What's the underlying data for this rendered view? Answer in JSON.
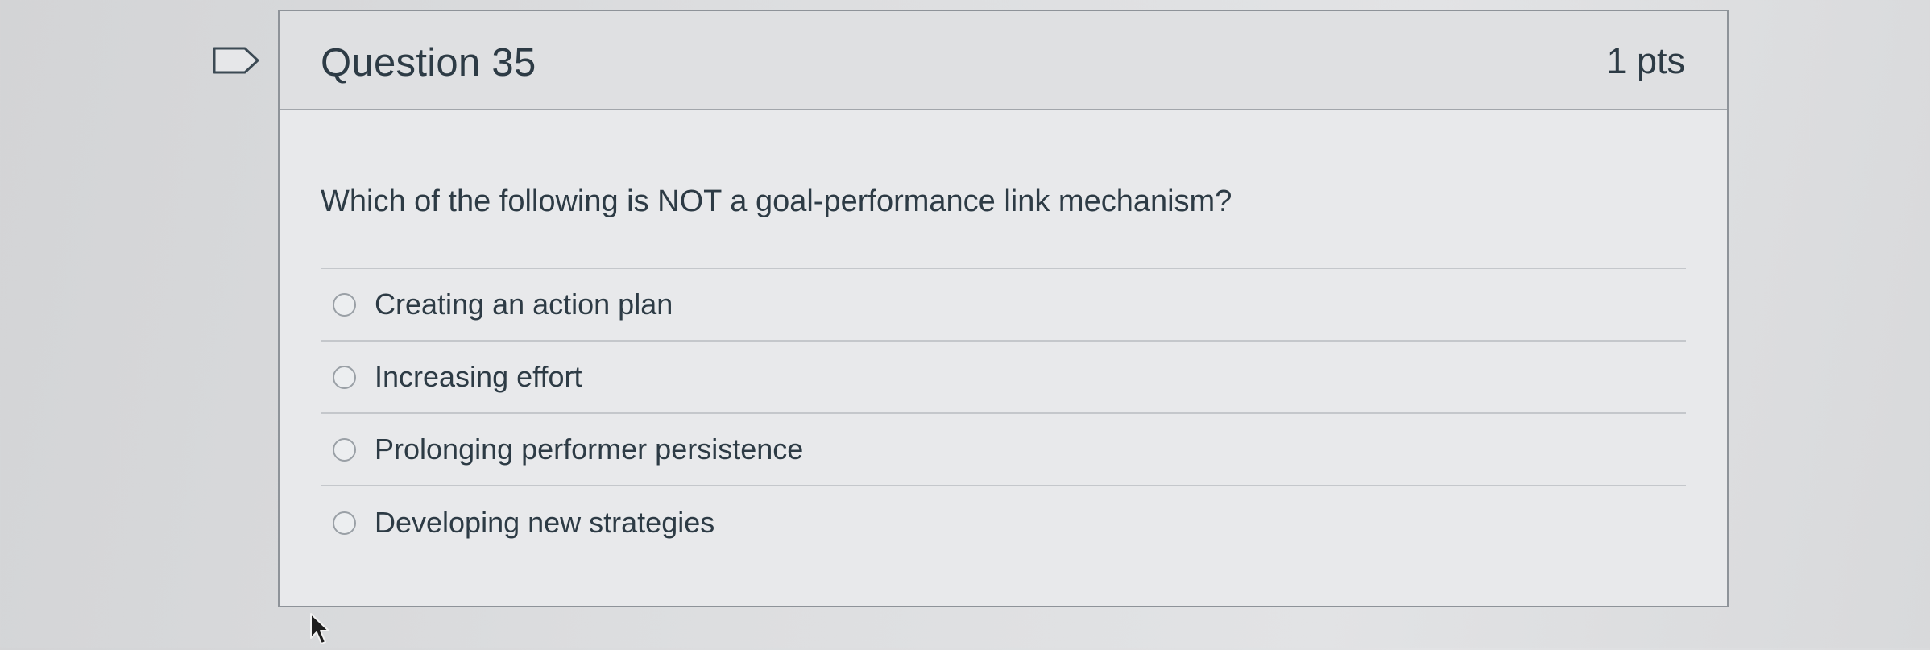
{
  "question": {
    "title": "Question 35",
    "points": "1 pts",
    "text": "Which of the following is NOT a goal-performance link mechanism?",
    "answers": [
      {
        "label": "Creating an action plan",
        "selected": false
      },
      {
        "label": "Increasing effort",
        "selected": false
      },
      {
        "label": "Prolonging performer persistence",
        "selected": false
      },
      {
        "label": "Developing new strategies",
        "selected": false
      }
    ]
  },
  "icons": {
    "flag": "flag-question-icon",
    "radio": "radio-button-icon",
    "cursor": "mouse-pointer-icon"
  }
}
